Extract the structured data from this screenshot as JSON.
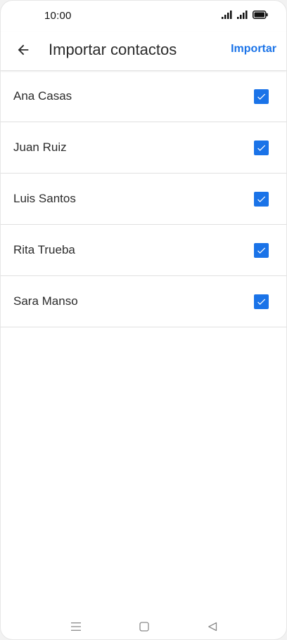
{
  "status_bar": {
    "time": "10:00"
  },
  "app_bar": {
    "title": "Importar contactos",
    "import_label": "Importar",
    "accent_color": "#1a73e8"
  },
  "contacts": [
    {
      "name": "Ana Casas",
      "checked": true
    },
    {
      "name": "Juan Ruiz",
      "checked": true
    },
    {
      "name": "Luis Santos",
      "checked": true
    },
    {
      "name": "Rita Trueba",
      "checked": true
    },
    {
      "name": "Sara Manso",
      "checked": true
    }
  ],
  "icons": {
    "back": "arrow-left-icon",
    "checkbox": "checkmark-icon",
    "signal": "signal-icon",
    "battery": "battery-icon",
    "nav_menu": "menu-icon",
    "nav_home": "square-icon",
    "nav_back": "triangle-back-icon"
  }
}
